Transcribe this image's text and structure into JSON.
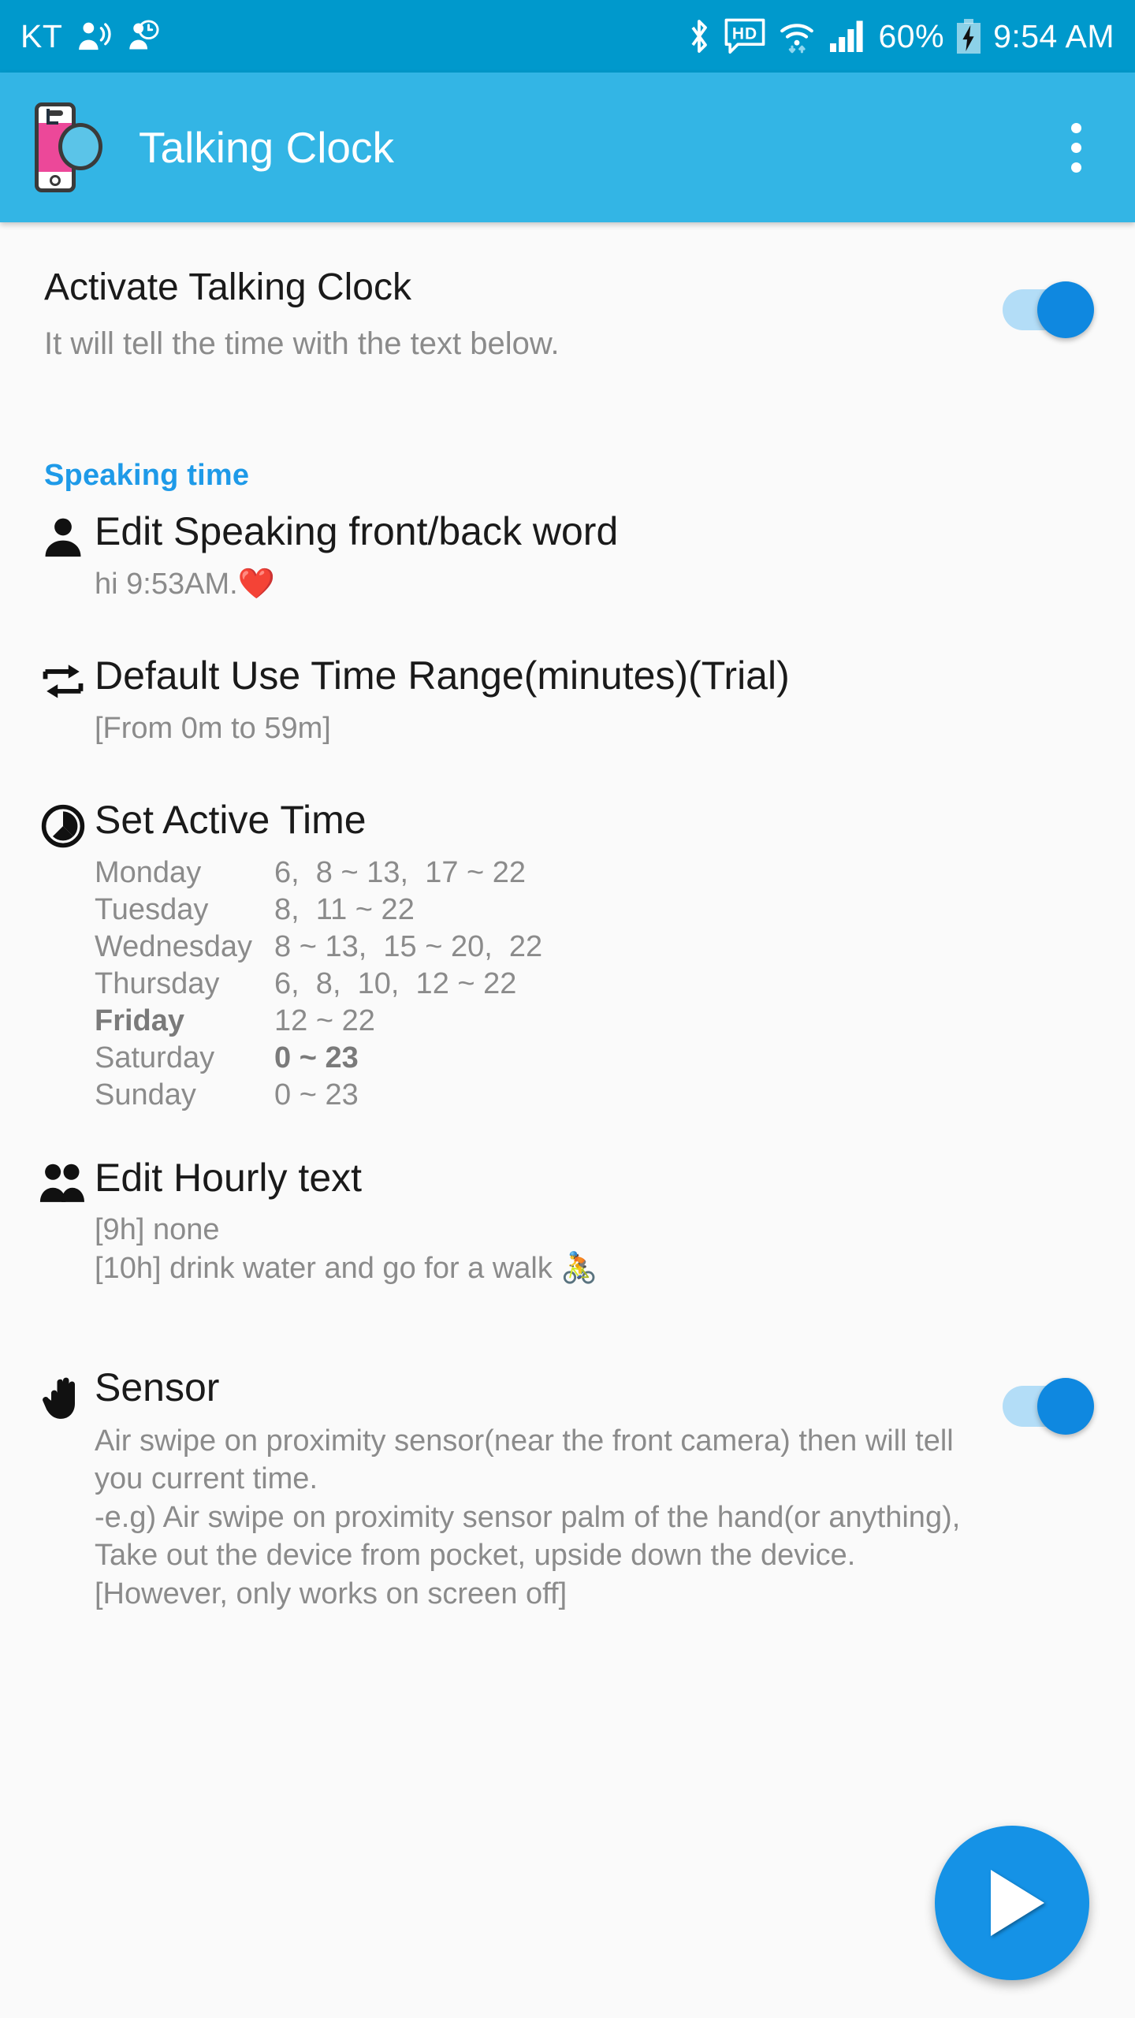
{
  "status_bar": {
    "carrier": "KT",
    "icons_left": [
      "voice-assistant-icon",
      "clock-person-icon"
    ],
    "icons_right": [
      "bluetooth-icon",
      "hd-voice-icon",
      "wifi-icon",
      "signal-icon"
    ],
    "battery_percent": "60%",
    "battery_state": "charging",
    "time": "9:54 AM",
    "bg_color": "#0099cc"
  },
  "app_bar": {
    "logo_icon": "talking-clock-logo",
    "title": "Talking Clock",
    "overflow_icon": "overflow-menu-icon",
    "bg_color": "#33b5e5"
  },
  "master_switch": {
    "title": "Activate Talking Clock",
    "subtitle": "It will tell the time with the text below.",
    "enabled": true
  },
  "sections": [
    {
      "header": "Speaking time",
      "header_color": "#1e9ae8"
    }
  ],
  "prefs": {
    "speaking_word": {
      "icon": "person-icon",
      "title": "Edit Speaking front/back word",
      "subtitle": "hi  9:53AM.",
      "emoji": "❤️"
    },
    "time_range": {
      "icon": "swap-arrows-icon",
      "title": "Default Use Time Range(minutes)(Trial)",
      "subtitle": "[From 0m to 59m]"
    },
    "active_time": {
      "icon": "pie-timer-icon",
      "title": "Set Active Time",
      "schedule": [
        {
          "day": "Monday",
          "value": "6,  8 ~ 13,  17 ~ 22",
          "day_bold": false,
          "value_bold": false
        },
        {
          "day": "Tuesday",
          "value": "8,  11 ~ 22",
          "day_bold": false,
          "value_bold": false
        },
        {
          "day": "Wednesday",
          "value": "8 ~ 13,  15 ~ 20,  22",
          "day_bold": false,
          "value_bold": false
        },
        {
          "day": "Thursday",
          "value": "6,  8,  10,  12 ~ 22",
          "day_bold": false,
          "value_bold": false
        },
        {
          "day": "Friday",
          "value": "12 ~ 22",
          "day_bold": true,
          "value_bold": false
        },
        {
          "day": "Saturday",
          "value": "0 ~ 23",
          "day_bold": false,
          "value_bold": true
        },
        {
          "day": "Sunday",
          "value": "0 ~ 23",
          "day_bold": false,
          "value_bold": false
        }
      ]
    },
    "hourly_text": {
      "icon": "people-icon",
      "title": "Edit Hourly text",
      "lines": [
        "[9h] none",
        "[10h] drink water and go for a walk 🚴"
      ]
    },
    "sensor": {
      "icon": "hand-icon",
      "title": "Sensor",
      "enabled": true,
      "description": "Air swipe on proximity sensor(near the front camera) then will tell you current time.\n-e.g) Air swipe on proximity sensor palm of the hand(or anything), Take out the device from pocket, upside down the device. [However, only works on screen off]"
    }
  },
  "fab": {
    "icon": "play-icon",
    "color": "#1592e6"
  }
}
